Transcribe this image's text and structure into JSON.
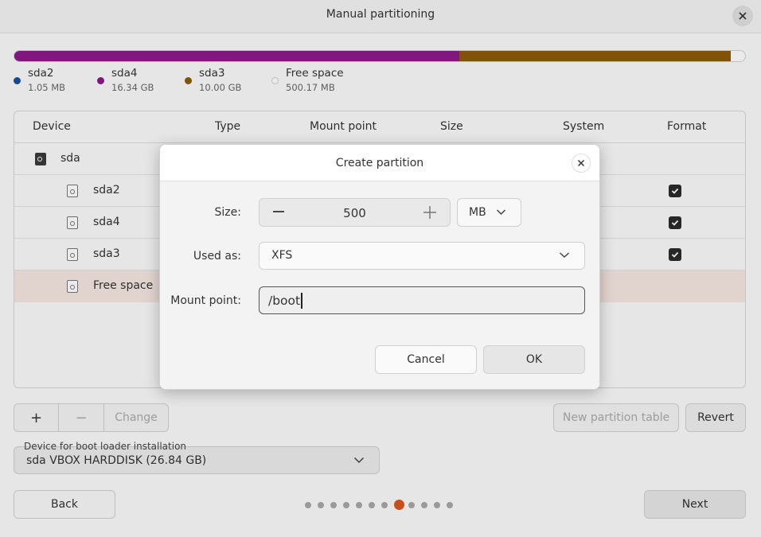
{
  "window": {
    "title": "Manual partitioning"
  },
  "usage": {
    "segments": [
      {
        "name": "sda2",
        "fraction": 0.0004,
        "color": "#1b4f9c"
      },
      {
        "name": "sda4",
        "fraction": 0.608,
        "color": "#8a1a8a"
      },
      {
        "name": "sda3",
        "fraction": 0.372,
        "color": "#8c5a0b"
      },
      {
        "name": "Free space",
        "fraction": 0.0186,
        "color": "#ffffff"
      }
    ]
  },
  "legend": [
    {
      "name": "sda2",
      "size": "1.05 MB",
      "color": "#1b4f9c"
    },
    {
      "name": "sda4",
      "size": "16.34 GB",
      "color": "#8a1a8a"
    },
    {
      "name": "sda3",
      "size": "10.00 GB",
      "color": "#8c5a0b"
    },
    {
      "name": "Free space",
      "size": "500.17 MB",
      "color": "#ffffff"
    }
  ],
  "table": {
    "headers": {
      "device": "Device",
      "type": "Type",
      "mount": "Mount point",
      "size": "Size",
      "system": "System",
      "format": "Format"
    },
    "rows": [
      {
        "device": "sda"
      },
      {
        "device": "sda2"
      },
      {
        "device": "sda4"
      },
      {
        "device": "sda3"
      },
      {
        "device": "Free space"
      }
    ]
  },
  "toolbar": {
    "add": "+",
    "remove": "−",
    "change": "Change",
    "new_table": "New partition table",
    "revert": "Revert"
  },
  "bootloader": {
    "label": "Device for boot loader installation",
    "value": "sda VBOX HARDDISK (26.84 GB)"
  },
  "nav": {
    "back": "Back",
    "next": "Next",
    "page_count": 12,
    "current_page": 8
  },
  "dialog": {
    "title": "Create partition",
    "size_label": "Size:",
    "size_value": "500",
    "unit": "MB",
    "used_as_label": "Used as:",
    "used_as_value": "XFS",
    "mount_label": "Mount point:",
    "mount_value": "/boot",
    "cancel": "Cancel",
    "ok": "OK"
  }
}
